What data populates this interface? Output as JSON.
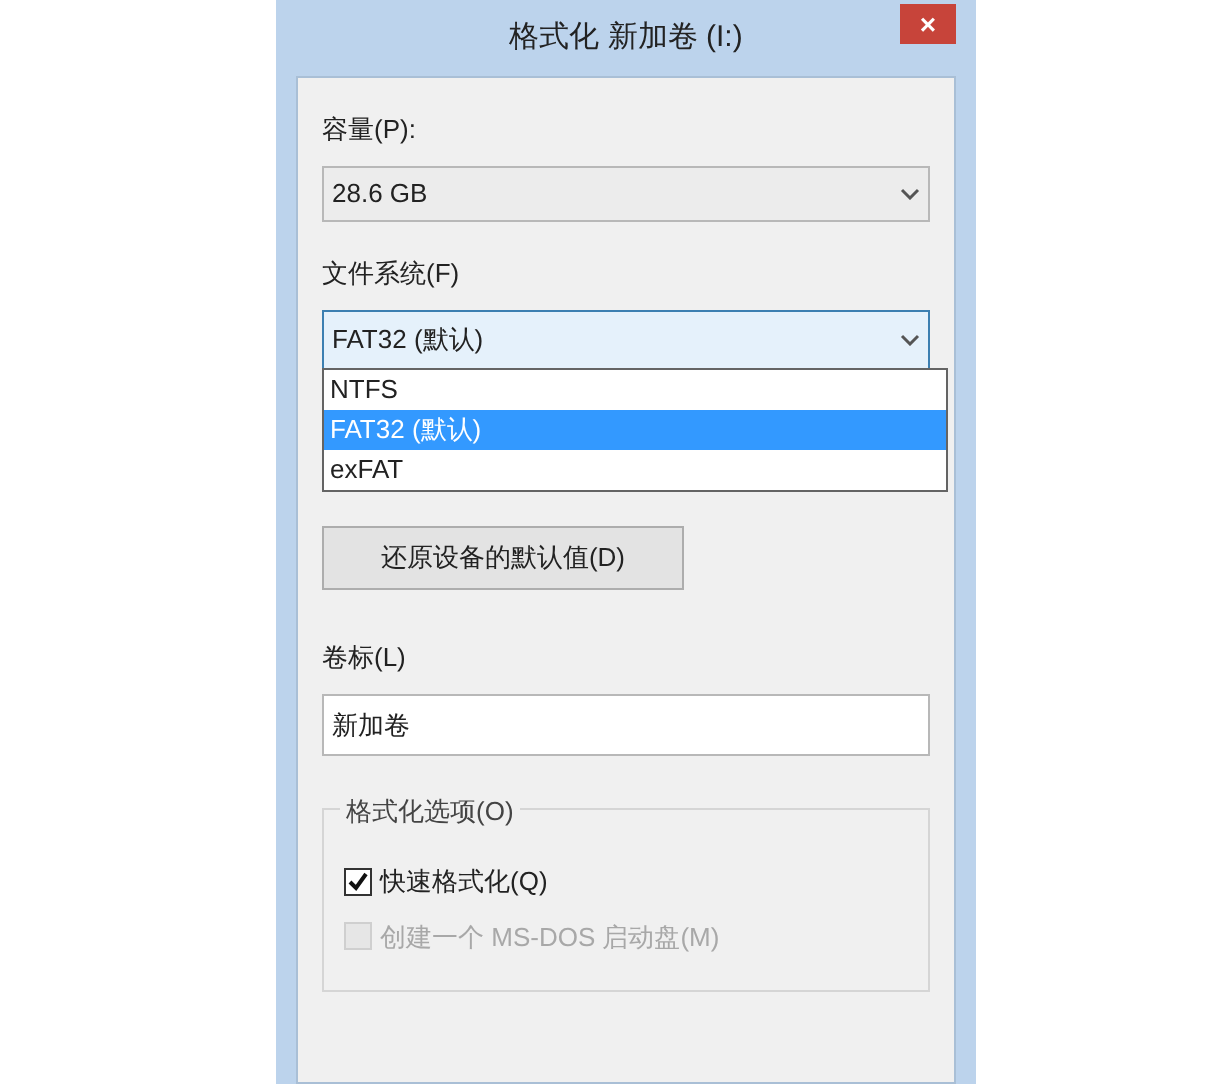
{
  "window": {
    "title": "格式化 新加卷 (I:)",
    "close": "×"
  },
  "capacity": {
    "label": "容量(P):",
    "value": "28.6 GB"
  },
  "file_system": {
    "label": "文件系统(F)",
    "value": "FAT32 (默认)",
    "expanded": true,
    "options": [
      {
        "label": "NTFS",
        "selected": false
      },
      {
        "label": "FAT32 (默认)",
        "selected": true
      },
      {
        "label": "exFAT",
        "selected": false
      }
    ]
  },
  "restore_button": "还原设备的默认值(D)",
  "volume_label": {
    "label": "卷标(L)",
    "value": "新加卷"
  },
  "format_options": {
    "title": "格式化选项(O)",
    "items": [
      {
        "label": "快速格式化(Q)",
        "checked": true,
        "disabled": false
      },
      {
        "label": "创建一个 MS-DOS 启动盘(M)",
        "checked": false,
        "disabled": true
      }
    ]
  }
}
